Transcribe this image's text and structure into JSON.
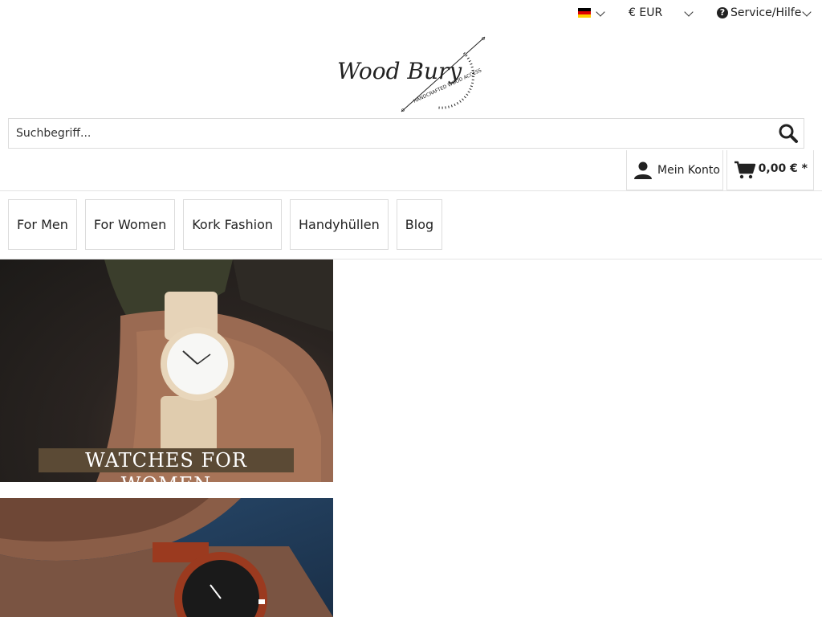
{
  "header": {
    "language": {
      "flag_colors": [
        "#000000",
        "#dd0000",
        "#ffce00"
      ]
    },
    "currency": {
      "label": "€ EUR"
    },
    "service": {
      "label": "Service/Hilfe"
    }
  },
  "logo": {
    "text": "Wood Bury",
    "tagline": "HANDCRAFTED WOOD ACCESS"
  },
  "search": {
    "placeholder": "Suchbegriff..."
  },
  "account": {
    "label": "Mein Konto"
  },
  "cart": {
    "total": "0,00 € *"
  },
  "nav": {
    "items": [
      {
        "label": "For Men"
      },
      {
        "label": "For Women"
      },
      {
        "label": "Kork Fashion"
      },
      {
        "label": "Handyhüllen"
      },
      {
        "label": "Blog"
      }
    ]
  },
  "banners": [
    {
      "caption": "WATCHES FOR WOMEN"
    },
    {
      "caption": ""
    }
  ]
}
